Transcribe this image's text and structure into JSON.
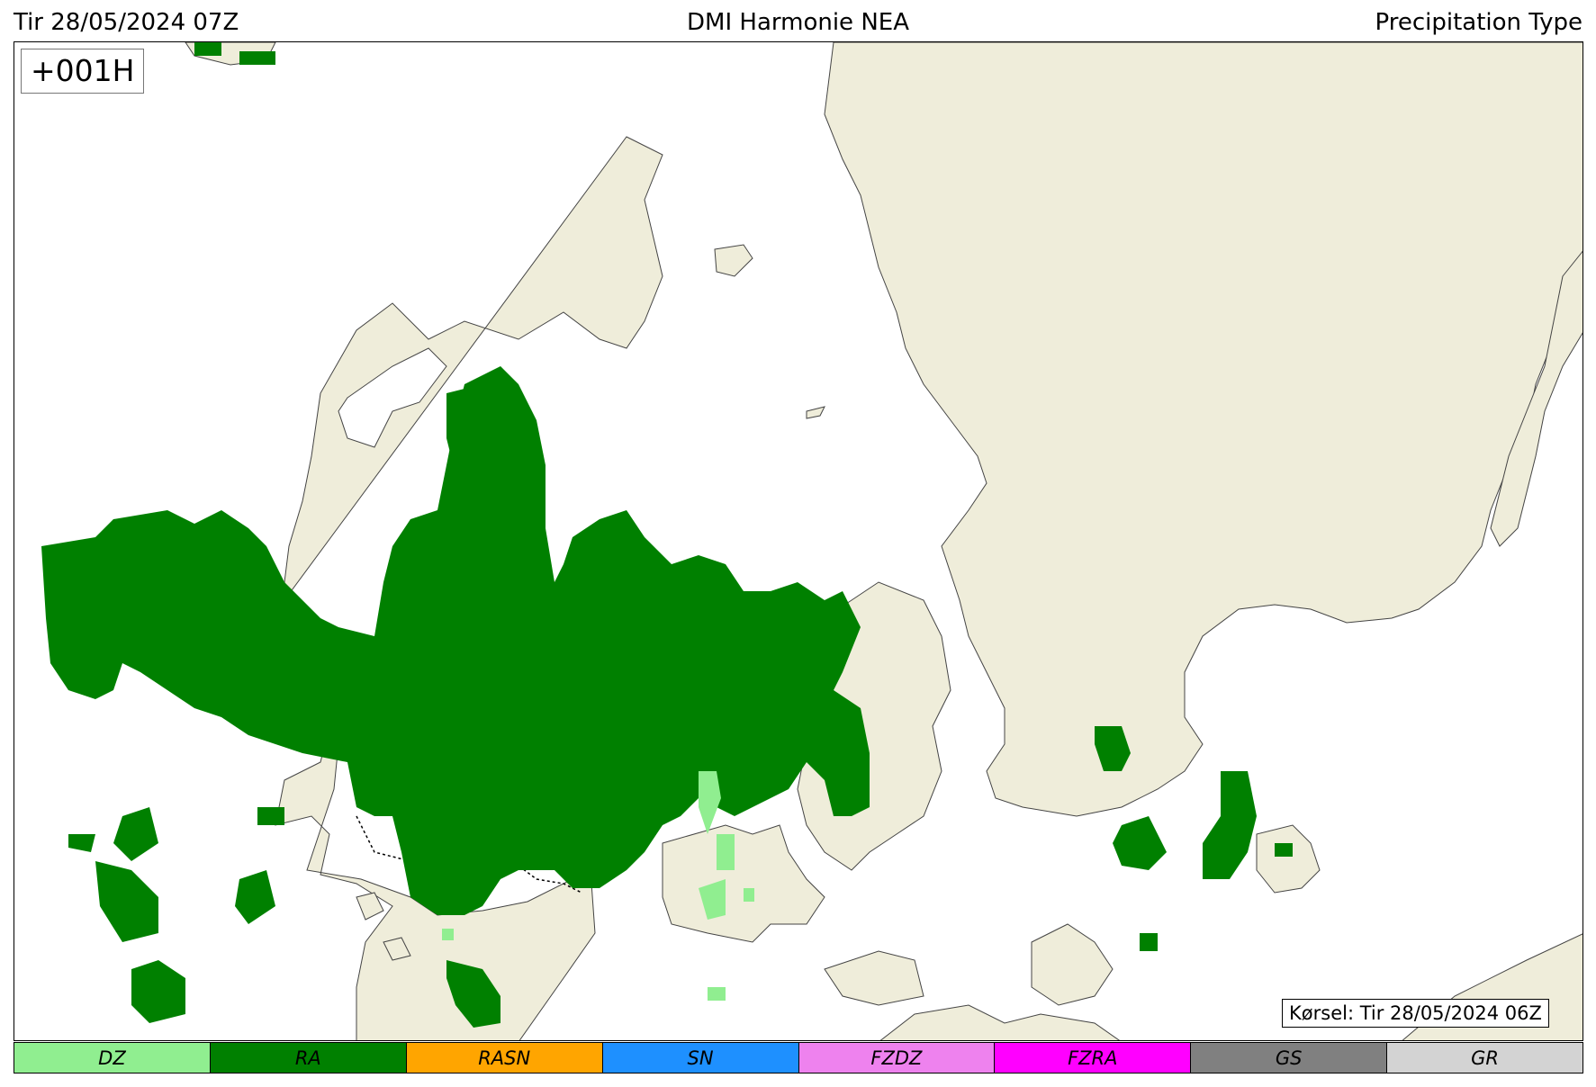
{
  "header": {
    "valid_time": "Tir 28/05/2024 07Z",
    "model": "DMI Harmonie NEA",
    "product": "Precipitation Type"
  },
  "map": {
    "lead_time": "+001H",
    "run_label": "Kørsel: Tir 28/05/2024 06Z",
    "colors": {
      "land": "#efedda",
      "sea": "#ffffff",
      "coast": "#444444",
      "border": "#000000"
    }
  },
  "legend": {
    "items": [
      {
        "code": "DZ",
        "color": "#90ee90"
      },
      {
        "code": "RA",
        "color": "#008000"
      },
      {
        "code": "RASN",
        "color": "#ffa500"
      },
      {
        "code": "SN",
        "color": "#1e90ff"
      },
      {
        "code": "FZDZ",
        "color": "#ee82ee"
      },
      {
        "code": "FZRA",
        "color": "#ff00ff"
      },
      {
        "code": "GS",
        "color": "#808080"
      },
      {
        "code": "GR",
        "color": "#d3d3d3"
      }
    ]
  }
}
